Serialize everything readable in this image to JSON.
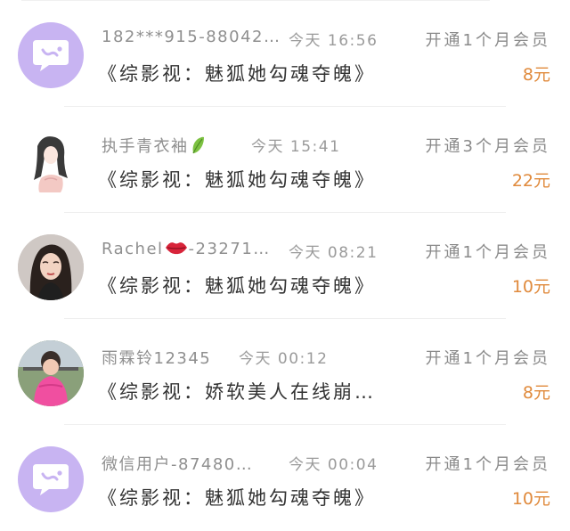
{
  "orders": [
    {
      "avatar": "chat-bubble-icon",
      "name": "182***915-88042…",
      "time": "今天 16:56",
      "order": "开通1个月会员",
      "title": "《综影视：魅狐她勾魂夺魄》",
      "price": "8元"
    },
    {
      "avatar": "anime-girl-avatar",
      "name": "执手青衣袖",
      "name_icon": "leaf-icon",
      "time": "今天 15:41",
      "order": "开通3个月会员",
      "title": "《综影视：魅狐她勾魂夺魄》",
      "price": "22元"
    },
    {
      "avatar": "woman-photo-avatar",
      "name_prefix": "Rachel",
      "name_icon": "lips-icon",
      "name": "-23271…",
      "time": "今天 08:21",
      "order": "开通1个月会员",
      "title": "《综影视：魅狐她勾魂夺魄》",
      "price": "10元"
    },
    {
      "avatar": "child-photo-avatar",
      "name": "雨霖铃12345",
      "time": "今天 00:12",
      "order": "开通1个月会员",
      "title": "《综影视：娇软美人在线崩…",
      "price": "8元"
    },
    {
      "avatar": "chat-bubble-icon",
      "name": "微信用户-87480…",
      "time": "今天 00:04",
      "order": "开通1个月会员",
      "title": "《综影视：魅狐她勾魂夺魄》",
      "price": "10元"
    }
  ],
  "colors": {
    "price": "#e08a3c",
    "default_avatar_bg": "#c8b4f2",
    "meta_text": "#8f8f8f"
  }
}
